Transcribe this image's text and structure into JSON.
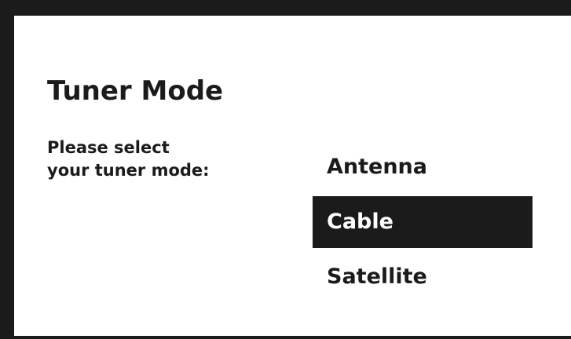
{
  "dialog": {
    "title": "Tuner Mode",
    "prompt_line1": "Please select",
    "prompt_line2": "your tuner mode:"
  },
  "options": [
    {
      "label": "Antenna",
      "selected": false
    },
    {
      "label": "Cable",
      "selected": true
    },
    {
      "label": "Satellite",
      "selected": false
    }
  ],
  "colors": {
    "background": "#1b1b1b",
    "panel": "#ffffff",
    "selected_bg": "#1b1b1b",
    "selected_text": "#ffffff",
    "text": "#1b1b1b"
  }
}
